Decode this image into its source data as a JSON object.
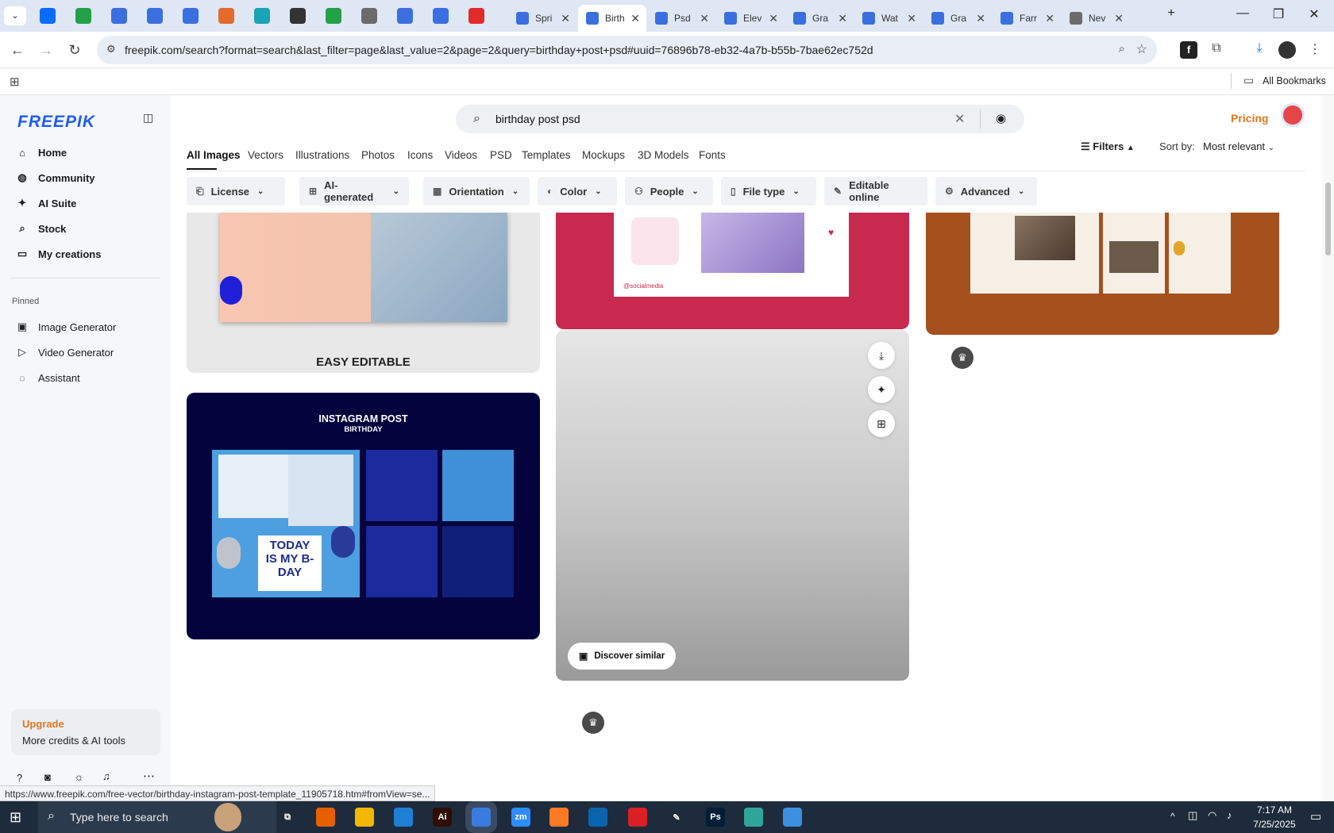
{
  "browser": {
    "tabs": [
      {
        "label": "Spri",
        "color": "#3b6fe0"
      },
      {
        "label": "Birth",
        "color": "#3b6fe0",
        "active": true
      },
      {
        "label": "Psd",
        "color": "#3b6fe0"
      },
      {
        "label": "Elev",
        "color": "#3b6fe0"
      },
      {
        "label": "Gra",
        "color": "#3b6fe0"
      },
      {
        "label": "Wat",
        "color": "#3b6fe0"
      },
      {
        "label": "Gra",
        "color": "#3b6fe0"
      },
      {
        "label": "Farr",
        "color": "#3b6fe0"
      },
      {
        "label": "Nev",
        "color": "#6b6b6b"
      }
    ],
    "pinned_tab_colors": [
      "#0a6cff",
      "#24a148",
      "#3b6fe0",
      "#3b6fe0",
      "#3b6fe0",
      "#e36b2c",
      "#1aa2b5",
      "#333333",
      "#24a148",
      "#6b6b6b",
      "#3b6fe0",
      "#3b6fe0",
      "#e02b2b"
    ],
    "url": "freepik.com/search?format=search&last_filter=page&last_value=2&page=2&query=birthday+post+psd#uuid=76896b78-eb32-4a7b-b55b-7bae62ec752d",
    "bookmarks_label": "All Bookmarks",
    "status_url": "https://www.freepik.com/free-vector/birthday-instagram-post-template_11905718.htm#fromView=se..."
  },
  "sidebar": {
    "logo": "FREEPIK",
    "nav": [
      {
        "label": "Home",
        "icon": "home-icon",
        "glyph": "⌂"
      },
      {
        "label": "Community",
        "icon": "globe-icon",
        "glyph": "◍"
      },
      {
        "label": "AI Suite",
        "icon": "sparkle-icon",
        "glyph": "✦"
      },
      {
        "label": "Stock",
        "icon": "search-icon",
        "glyph": "⌕"
      },
      {
        "label": "My creations",
        "icon": "folder-icon",
        "glyph": "▭"
      }
    ],
    "pinned_heading": "Pinned",
    "pinned": [
      {
        "label": "Image Generator",
        "icon": "image-icon",
        "glyph": "▣"
      },
      {
        "label": "Video Generator",
        "icon": "video-icon",
        "glyph": "▷"
      },
      {
        "label": "Assistant",
        "icon": "chat-icon",
        "glyph": "◌"
      }
    ],
    "upgrade_title": "Upgrade",
    "upgrade_sub": "More credits & AI tools"
  },
  "search": {
    "query": "birthday post psd",
    "pricing": "Pricing"
  },
  "categories": [
    "All Images",
    "Vectors",
    "Illustrations",
    "Photos",
    "Icons",
    "Videos",
    "PSD",
    "Templates",
    "Mockups",
    "3D Models",
    "Fonts"
  ],
  "filters_label": "Filters",
  "sort_label": "Sort by:",
  "sort_value": "Most relevant",
  "filter_chips": [
    {
      "label": "License",
      "icon": "license-icon",
      "glyph": "⎗"
    },
    {
      "label": "AI-generated",
      "icon": "ai-icon",
      "glyph": "⊞"
    },
    {
      "label": "Orientation",
      "icon": "orientation-icon",
      "glyph": "▦"
    },
    {
      "label": "Color",
      "icon": "palette-icon",
      "glyph": "◐"
    },
    {
      "label": "People",
      "icon": "people-icon",
      "glyph": "⚇"
    },
    {
      "label": "File type",
      "icon": "file-icon",
      "glyph": "▯"
    },
    {
      "label": "Editable online",
      "icon": "pencil-icon",
      "glyph": "✎",
      "no_chevron": true
    },
    {
      "label": "Advanced",
      "icon": "gear-icon",
      "glyph": "⚙"
    }
  ],
  "cards": {
    "easy_editable": "EASY EDITABLE",
    "insta_title": "INSTAGRAM POST",
    "insta_sub": "BIRTHDAY",
    "today_text": "TODAY IS MY B-DAY",
    "social_tag": "@socialmedia",
    "discover": "Discover similar"
  },
  "taskbar": {
    "search_placeholder": "Type here to search",
    "time": "7:17 AM",
    "date": "7/25/2025"
  }
}
